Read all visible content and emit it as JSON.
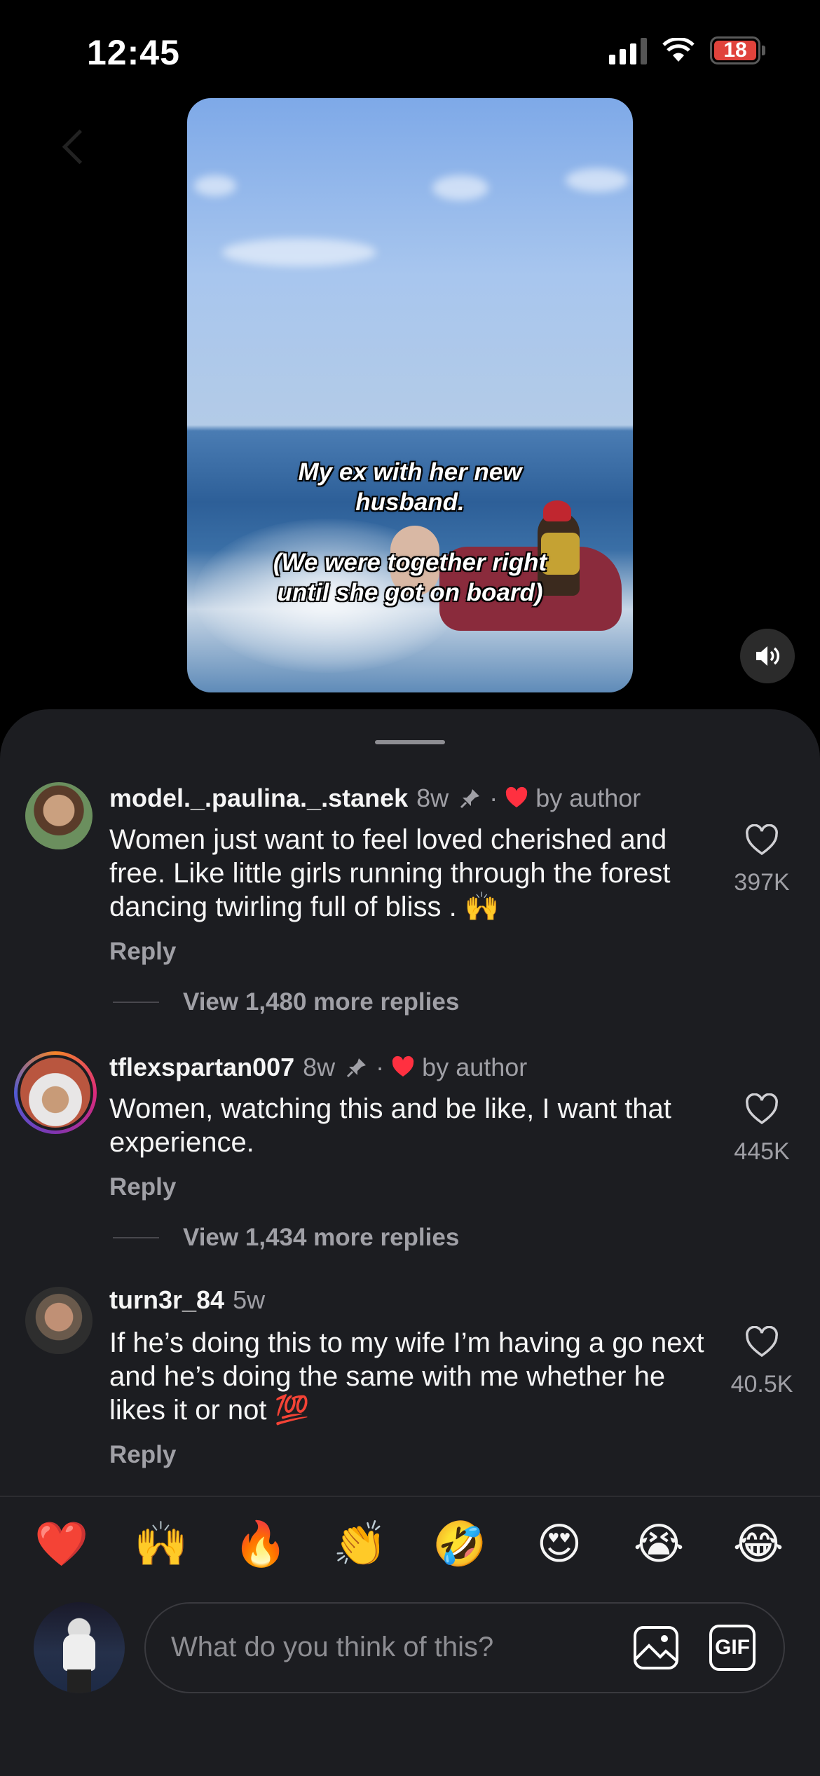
{
  "status_bar": {
    "time": "12:45",
    "battery": "18"
  },
  "video": {
    "caption": "My ex with her new\nhusband.\n\n(We were together right\nuntil she got on board)"
  },
  "comments": [
    {
      "username": "model._.paulina._.stanek",
      "time": "8w",
      "pinned": true,
      "liked_by_author": true,
      "by_author_label": "by author",
      "text": "Women just want to feel loved cherished and free. Like little girls running through the forest dancing twirling full of bliss . 🙌",
      "reply_label": "Reply",
      "more_replies": "View 1,480 more replies",
      "likes": "397K"
    },
    {
      "username": "tflexspartan007",
      "time": "8w",
      "pinned": true,
      "liked_by_author": true,
      "by_author_label": "by author",
      "text": "Women, watching this and be like, I want that experience.",
      "reply_label": "Reply",
      "more_replies": "View 1,434 more replies",
      "likes": "445K"
    },
    {
      "username": "turn3r_84",
      "time": "5w",
      "text": "If he’s doing this to my wife I’m having a go next and he’s doing the same with me whether he likes it or not 💯",
      "reply_label": "Reply",
      "likes": "40.5K"
    }
  ],
  "emoji_bar": [
    "❤️",
    "🙌",
    "🔥",
    "👏",
    "🤣",
    "😍",
    "😭",
    "😂"
  ],
  "input": {
    "placeholder": "What do you think of this?",
    "gif_label": "GIF"
  },
  "colors": {
    "sheet": "#1c1d21",
    "secondary_text": "#a0a0a6",
    "heart_red": "#ff3040"
  }
}
